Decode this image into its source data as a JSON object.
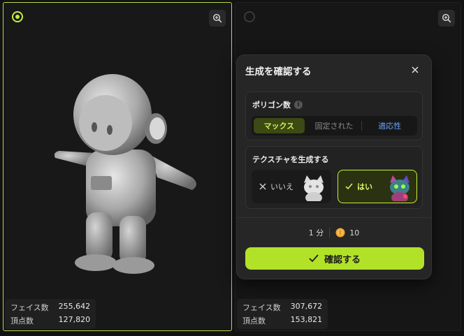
{
  "left_panel": {
    "stats": {
      "faces_label": "フェイス数",
      "faces_value": "255,642",
      "vertices_label": "頂点数",
      "vertices_value": "127,820"
    }
  },
  "right_panel": {
    "stats": {
      "faces_label": "フェイス数",
      "faces_value": "307,672",
      "vertices_label": "頂点数",
      "vertices_value": "153,821"
    }
  },
  "dialog": {
    "title": "生成を確認する",
    "polygon": {
      "label": "ポリゴン数",
      "options": [
        "マックス",
        "固定された",
        "適応性"
      ],
      "selected": "マックス"
    },
    "texture": {
      "label": "テクスチャを生成する",
      "no_label": "いいえ",
      "yes_label": "はい",
      "selected": "はい"
    },
    "time": "1 分",
    "credits": "10",
    "confirm_label": "確認する"
  },
  "icons": {
    "radio": "radio-icon",
    "zoom": "zoom-in-icon",
    "close": "close-icon",
    "info": "info-icon",
    "check": "check-icon",
    "x": "x-icon",
    "coin": "coin-icon"
  },
  "colors": {
    "accent": "#b2e228",
    "link": "#6aa3ff",
    "selected_border": "#c6ef3a"
  }
}
